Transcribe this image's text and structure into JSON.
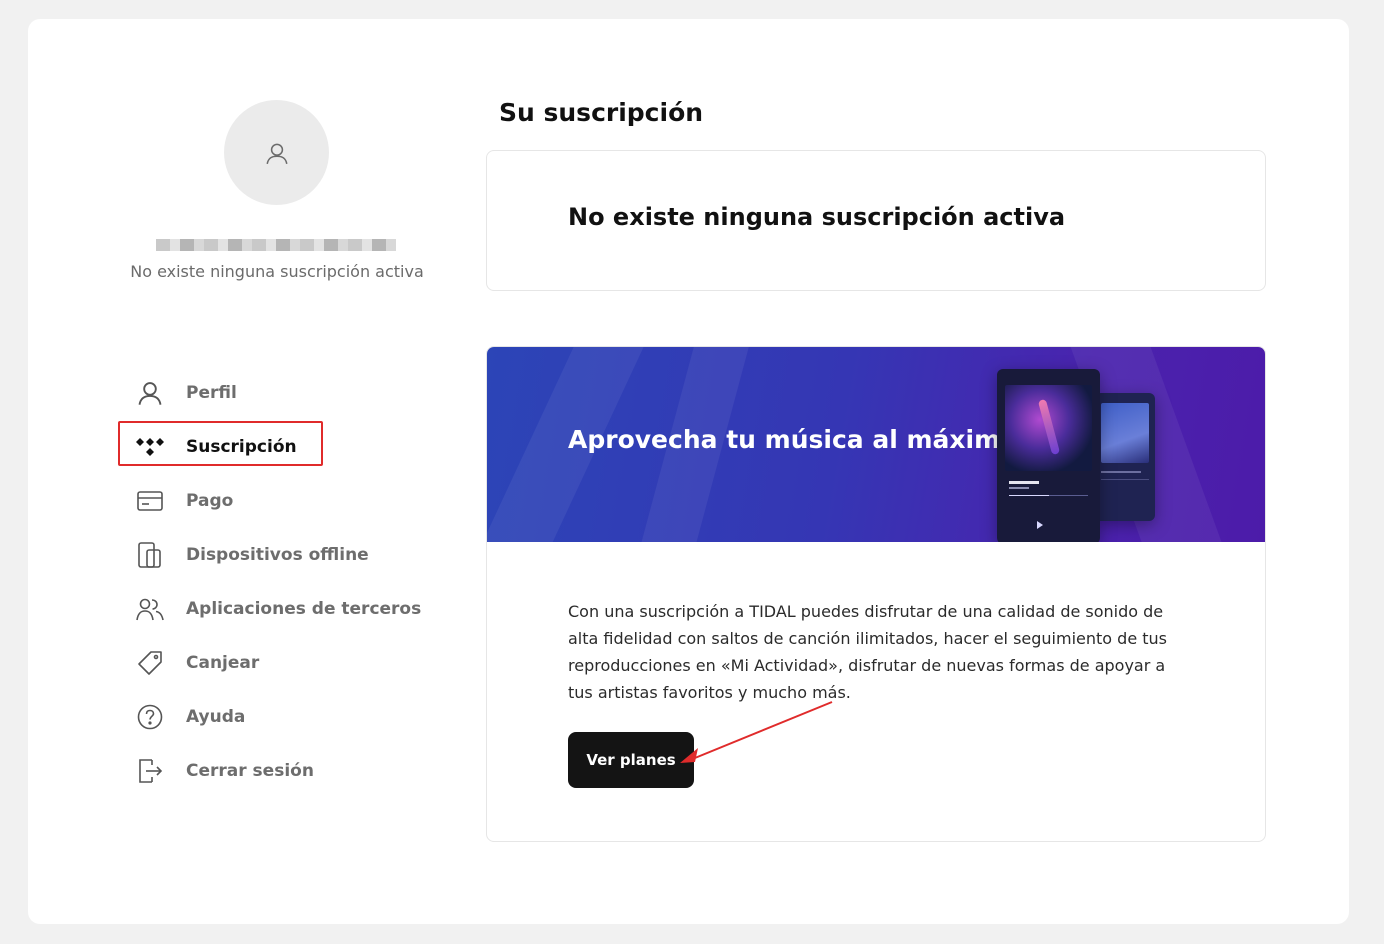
{
  "profile": {
    "subtitle": "No existe ninguna suscripción activa"
  },
  "nav": {
    "items": [
      {
        "label": "Perfil",
        "icon": "user-icon"
      },
      {
        "label": "Suscripción",
        "icon": "tidal-logo-icon",
        "active": true
      },
      {
        "label": "Pago",
        "icon": "credit-card-icon"
      },
      {
        "label": "Dispositivos offline",
        "icon": "devices-icon"
      },
      {
        "label": "Aplicaciones de terceros",
        "icon": "users-icon"
      },
      {
        "label": "Canjear",
        "icon": "tag-icon"
      },
      {
        "label": "Ayuda",
        "icon": "help-circle-icon"
      },
      {
        "label": "Cerrar sesión",
        "icon": "logout-icon"
      }
    ]
  },
  "main": {
    "title": "Su suscripción",
    "status": "No existe ninguna suscripción activa",
    "promo": {
      "title": "Aprovecha tu música al máximo",
      "body": "Con una suscripción a TIDAL puedes disfrutar de una calidad de sonido de alta fidelidad con saltos de canción ilimitados, hacer el seguimiento de tus reproducciones en «Mi Actividad», disfrutar de nuevas formas de apoyar a tus artistas favoritos y mucho más.",
      "button_label": "Ver planes"
    }
  },
  "colors": {
    "highlight": "#e02b2b",
    "banner_start": "#2c45b7",
    "banner_end": "#4c1ba9",
    "button": "#141414"
  }
}
